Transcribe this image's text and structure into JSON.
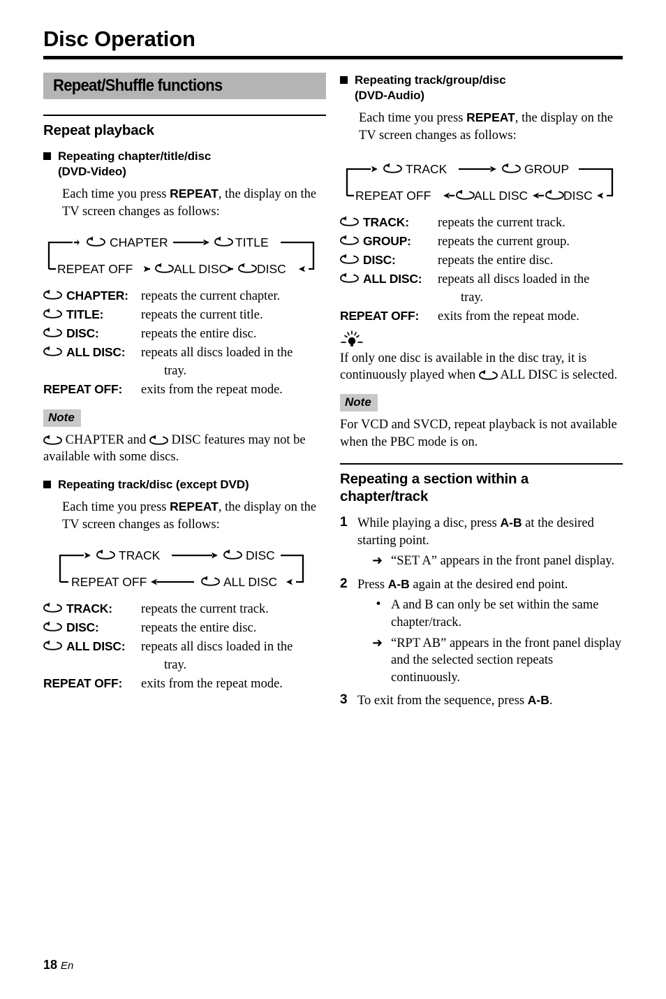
{
  "document": {
    "page_title": "Disc Operation",
    "footer": {
      "page_number": "18",
      "language": "En"
    },
    "colors": {
      "section_bar_gray": "#b4b4b4",
      "note_label_gray": "#c8c8c8",
      "text": "#000000"
    }
  },
  "left_column": {
    "section_bar": "Repeat/Shuffle functions",
    "heading": "Repeat playback",
    "sub1": {
      "title_line1": "Repeating chapter/title/disc",
      "title_line2": "(DVD-Video)",
      "intro_a": "Each time you press ",
      "intro_b": "REPEAT",
      "intro_c": ", the display on the TV screen changes as follows:",
      "diagram": {
        "top_row": [
          "CHAPTER",
          "TITLE"
        ],
        "bottom_row": [
          "REPEAT OFF",
          "ALL DISC",
          "DISC"
        ]
      },
      "definitions": [
        {
          "icon": "repeat-loop-icon",
          "term": "CHAPTER:",
          "desc": "repeats the current chapter."
        },
        {
          "icon": "repeat-loop-icon",
          "term": "TITLE:",
          "desc": "repeats the current title."
        },
        {
          "icon": "repeat-loop-icon",
          "term": "DISC:",
          "desc": "repeats the entire disc."
        },
        {
          "icon": "repeat-loop-icon",
          "term": "ALL DISC:",
          "desc": "repeats all discs loaded in the",
          "cont": "tray."
        },
        {
          "icon": "",
          "term": "REPEAT OFF:",
          "desc": "exits from the repeat mode."
        }
      ]
    },
    "note": {
      "label": "Note",
      "text_a": " CHAPTER and ",
      "text_b": " DISC features may not be available with some discs."
    },
    "sub2": {
      "title_line1": "Repeating track/disc (except DVD)",
      "intro_a": "Each time you press ",
      "intro_b": "REPEAT",
      "intro_c": ", the display on the TV screen changes as follows:",
      "diagram": {
        "top_row": [
          "TRACK",
          "DISC"
        ],
        "bottom_row": [
          "REPEAT OFF",
          "ALL DISC"
        ]
      },
      "definitions": [
        {
          "icon": "repeat-loop-icon",
          "term": "TRACK:",
          "desc": "repeats the current track."
        },
        {
          "icon": "repeat-loop-icon",
          "term": "DISC:",
          "desc": "repeats the entire disc."
        },
        {
          "icon": "repeat-loop-icon",
          "term": "ALL DISC:",
          "desc": "repeats all discs loaded in the",
          "cont": "tray."
        },
        {
          "icon": "",
          "term": "REPEAT OFF:",
          "desc": "exits from the repeat mode."
        }
      ]
    }
  },
  "right_column": {
    "sub1": {
      "title_line1": "Repeating track/group/disc",
      "title_line2": "(DVD-Audio)",
      "intro_a": "Each time you press ",
      "intro_b": "REPEAT",
      "intro_c": ", the display on the TV screen changes as follows:",
      "diagram": {
        "top_row": [
          "TRACK",
          "GROUP"
        ],
        "bottom_row": [
          "REPEAT OFF",
          "ALL DISC",
          "DISC"
        ]
      },
      "definitions": [
        {
          "icon": "repeat-loop-icon",
          "term": "TRACK:",
          "desc": "repeats the current track."
        },
        {
          "icon": "repeat-loop-icon",
          "term": "GROUP:",
          "desc": "repeats the current group."
        },
        {
          "icon": "repeat-loop-icon",
          "term": "DISC:",
          "desc": "repeats the entire disc."
        },
        {
          "icon": "repeat-loop-icon",
          "term": "ALL DISC:",
          "desc": "repeats all discs loaded in the",
          "cont": "tray."
        },
        {
          "icon": "",
          "term": "REPEAT OFF:",
          "desc": "exits from the repeat mode."
        }
      ]
    },
    "tip": {
      "icon": "tip-lightbulb-icon",
      "text_a": "If only one disc is available in the disc tray, it is continuously played when ",
      "text_b": " ALL DISC is selected."
    },
    "note": {
      "label": "Note",
      "text": "For VCD and SVCD, repeat playback is not available when the PBC mode is on."
    },
    "section": {
      "heading_line1": "Repeating a section within a",
      "heading_line2": "chapter/track",
      "steps": [
        {
          "num": "1",
          "text_a": "While playing a disc, press ",
          "text_b": "A-B",
          "text_c": " at the desired starting point.",
          "subs": [
            {
              "mark": "arrow",
              "text": "“SET A” appears in the front panel display."
            }
          ]
        },
        {
          "num": "2",
          "text_a": "Press ",
          "text_b": "A-B",
          "text_c": " again at the desired end point.",
          "subs": [
            {
              "mark": "bullet",
              "text": "A and B can only be set within the same chapter/track."
            },
            {
              "mark": "arrow",
              "text": "“RPT AB” appears in the front panel display and the selected section repeats continuously."
            }
          ]
        },
        {
          "num": "3",
          "text_a": "To exit from the sequence, press ",
          "text_b": "A-B",
          "text_c": ".",
          "subs": []
        }
      ]
    }
  }
}
